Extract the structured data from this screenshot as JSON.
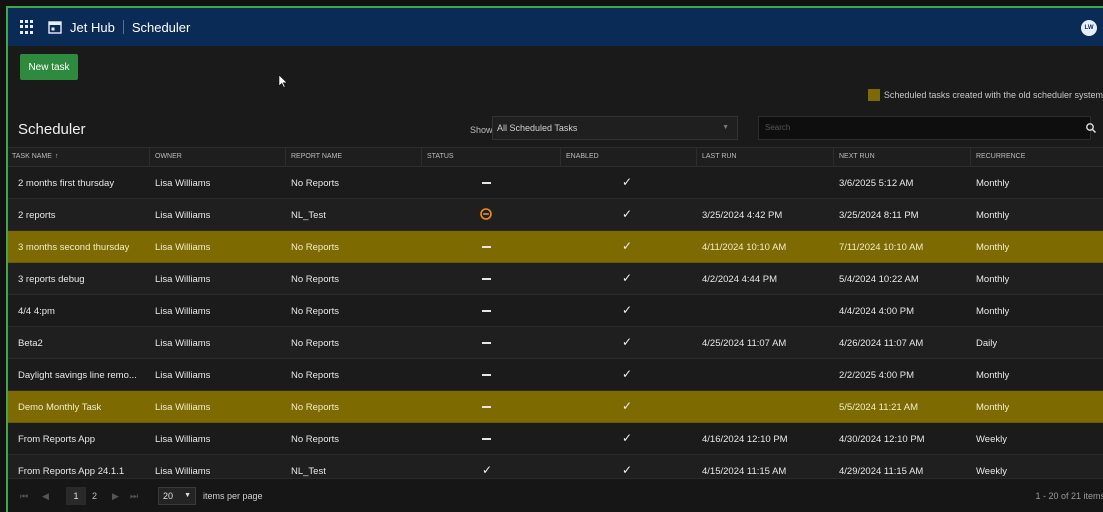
{
  "topbar": {
    "app_title": "Jet Hub",
    "module_title": "Scheduler",
    "user_initials": "LW"
  },
  "toolbar": {
    "new_task_label": "New task"
  },
  "legend": {
    "text": "Scheduled tasks created with the old scheduler system",
    "color": "#7d6a00"
  },
  "section": {
    "title": "Scheduler",
    "show_label": "Show",
    "filter_value": "All Scheduled Tasks",
    "search_placeholder": "Search"
  },
  "table": {
    "columns": [
      "TASK NAME",
      "OWNER",
      "REPORT NAME",
      "STATUS",
      "ENABLED",
      "LAST RUN",
      "NEXT RUN",
      "RECURRENCE"
    ],
    "sort_indicator": "↑",
    "rows": [
      {
        "task": "2 months first thursday",
        "owner": "Lisa Williams",
        "report": "No Reports",
        "status": "none",
        "enabled": "✓",
        "last_run": "",
        "next_run": "3/6/2025 5:12 AM",
        "recurrence": "Monthly",
        "legacy": false
      },
      {
        "task": "2 reports",
        "owner": "Lisa Williams",
        "report": "NL_Test",
        "status": "warning",
        "enabled": "✓",
        "last_run": "3/25/2024 4:42 PM",
        "next_run": "3/25/2024 8:11 PM",
        "recurrence": "Monthly",
        "legacy": false
      },
      {
        "task": "3 months second thursday",
        "owner": "Lisa Williams",
        "report": "No Reports",
        "status": "none",
        "enabled": "✓",
        "last_run": "4/11/2024 10:10 AM",
        "next_run": "7/11/2024 10:10 AM",
        "recurrence": "Monthly",
        "legacy": true
      },
      {
        "task": "3 reports debug",
        "owner": "Lisa Williams",
        "report": "No Reports",
        "status": "none",
        "enabled": "✓",
        "last_run": "4/2/2024 4:44 PM",
        "next_run": "5/4/2024 10:22 AM",
        "recurrence": "Monthly",
        "legacy": false
      },
      {
        "task": "4/4 4:pm",
        "owner": "Lisa Williams",
        "report": "No Reports",
        "status": "none",
        "enabled": "✓",
        "last_run": "",
        "next_run": "4/4/2024 4:00 PM",
        "recurrence": "Monthly",
        "legacy": false
      },
      {
        "task": "Beta2",
        "owner": "Lisa Williams",
        "report": "No Reports",
        "status": "none",
        "enabled": "✓",
        "last_run": "4/25/2024 11:07 AM",
        "next_run": "4/26/2024 11:07 AM",
        "recurrence": "Daily",
        "legacy": false
      },
      {
        "task": "Daylight savings line remo...",
        "owner": "Lisa Williams",
        "report": "No Reports",
        "status": "none",
        "enabled": "✓",
        "last_run": "",
        "next_run": "2/2/2025 4:00 PM",
        "recurrence": "Monthly",
        "legacy": false
      },
      {
        "task": "Demo Monthly Task",
        "owner": "Lisa Williams",
        "report": "No Reports",
        "status": "none",
        "enabled": "✓",
        "last_run": "",
        "next_run": "5/5/2024 11:21 AM",
        "recurrence": "Monthly",
        "legacy": true
      },
      {
        "task": "From Reports App",
        "owner": "Lisa Williams",
        "report": "No Reports",
        "status": "none",
        "enabled": "✓",
        "last_run": "4/16/2024 12:10 PM",
        "next_run": "4/30/2024 12:10 PM",
        "recurrence": "Weekly",
        "legacy": false
      },
      {
        "task": "From Reports App 24.1.1",
        "owner": "Lisa Williams",
        "report": "NL_Test",
        "status": "success",
        "enabled": "✓",
        "last_run": "4/15/2024 11:15 AM",
        "next_run": "4/29/2024 11:15 AM",
        "recurrence": "Weekly",
        "legacy": false
      }
    ]
  },
  "pager": {
    "current_page": "1",
    "next_page": "2",
    "page_size": "20",
    "items_per_page_label": "items per page",
    "range_text": "1 - 20 of 21 items"
  }
}
